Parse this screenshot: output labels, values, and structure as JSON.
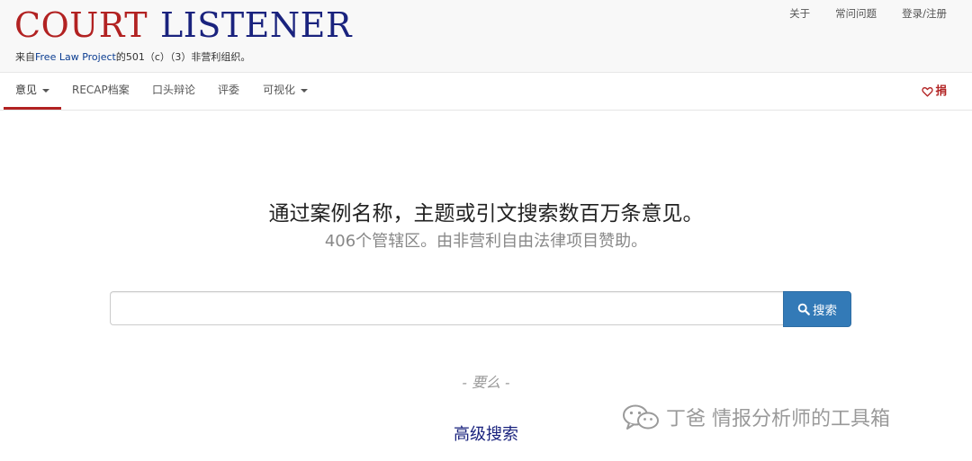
{
  "header": {
    "logo_word1": "COURT",
    "logo_word2": "LISTENER",
    "tagline_prefix": "来自",
    "tagline_link": "Free Law Project",
    "tagline_suffix": "的501（c）（3）非营利组织。",
    "top_links": [
      "关于",
      "常问问题",
      "登录/注册"
    ]
  },
  "nav": {
    "items": [
      "意见",
      "RECAP档案",
      "口头辩论",
      "评委",
      "可视化"
    ],
    "donate": "捐"
  },
  "hero": {
    "title": "通过案例名称，主题或引文搜索数百万条意见。",
    "subtitle": "406个管辖区。由非营利自由法律项目赞助。"
  },
  "search": {
    "placeholder": "",
    "button_label": "搜索"
  },
  "alt": {
    "or_text": "- 要么 -",
    "advanced_search": "高级搜索"
  },
  "watermark": {
    "text": "丁爸 情报分析师的工具箱",
    "icon": "wechat-icon"
  },
  "colors": {
    "brand_red": "#b22222",
    "brand_navy": "#1a237e",
    "primary_button": "#337ab7"
  }
}
